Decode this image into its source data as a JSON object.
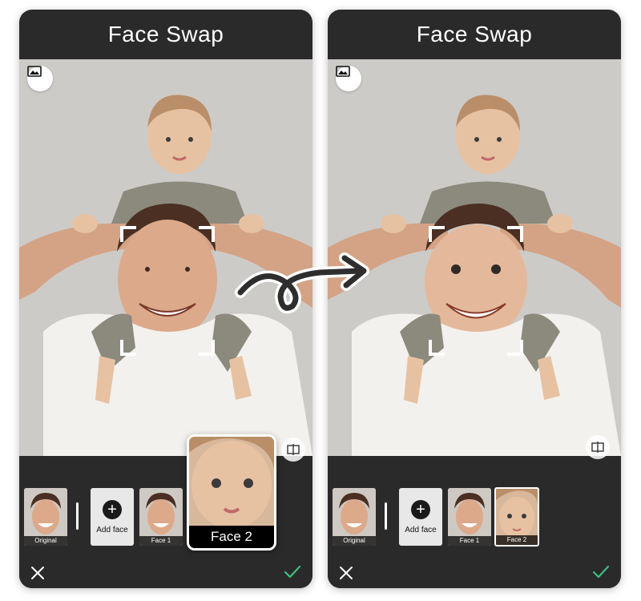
{
  "left_screen": {
    "title": "Face Swap",
    "faces": {
      "original_label": "Original",
      "add_face_label": "Add face",
      "face1_label": "Face 1"
    },
    "popup": {
      "label": "Face 2"
    }
  },
  "right_screen": {
    "title": "Face Swap",
    "faces": {
      "original_label": "Original",
      "add_face_label": "Add face",
      "face1_label": "Face 1",
      "face2_label": "Face 2"
    }
  },
  "colors": {
    "panel": "#2a2a2a",
    "photo_bg": "#cdcbc8",
    "confirm_green": "#3fbf7f"
  },
  "icons": [
    "gallery-icon",
    "compare-icon",
    "close-icon",
    "check-icon",
    "plus-icon",
    "curved-arrow-icon"
  ]
}
